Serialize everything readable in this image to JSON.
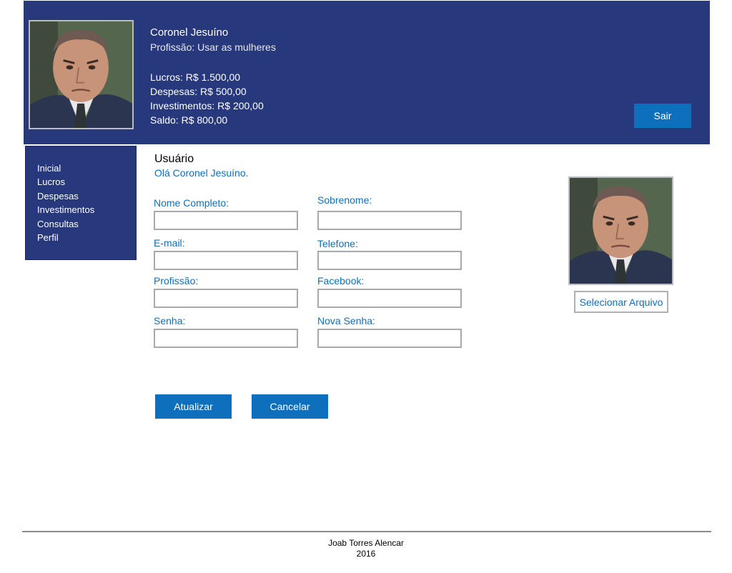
{
  "header": {
    "user_name": "Coronel Jesuíno",
    "profession": "Profissão: Usar as mulheres",
    "finance": {
      "lucros": "Lucros: R$ 1.500,00",
      "despesas": "Despesas: R$ 500,00",
      "investimentos": "Investimentos: R$ 200,00",
      "saldo": "Saldo: R$ 800,00"
    },
    "logout_label": "Sair"
  },
  "sidebar": {
    "items": [
      {
        "label": "Inicial"
      },
      {
        "label": "Lucros"
      },
      {
        "label": "Despesas"
      },
      {
        "label": "Investimentos"
      },
      {
        "label": "Consultas"
      },
      {
        "label": "Perfil"
      }
    ]
  },
  "main": {
    "title": "Usuário",
    "greeting": "Olá Coronel Jesuíno.",
    "fields": {
      "nome_completo": {
        "label": "Nome Completo:",
        "value": ""
      },
      "sobrenome": {
        "label": "Sobrenome:",
        "value": ""
      },
      "email": {
        "label": "E-mail:",
        "value": ""
      },
      "telefone": {
        "label": "Telefone:",
        "value": ""
      },
      "profissao": {
        "label": "Profissão:",
        "value": ""
      },
      "facebook": {
        "label": "Facebook:",
        "value": ""
      },
      "senha": {
        "label": "Senha:",
        "value": ""
      },
      "nova_senha": {
        "label": "Nova Senha:",
        "value": ""
      }
    },
    "update_label": "Atualizar",
    "cancel_label": "Cancelar",
    "select_file_label": "Selecionar Arquivo"
  },
  "footer": {
    "author": "Joab Torres Alencar",
    "year": "2016"
  },
  "colors": {
    "header_bg": "#27387d",
    "accent": "#0e70bd",
    "label": "#0e6fbd"
  }
}
